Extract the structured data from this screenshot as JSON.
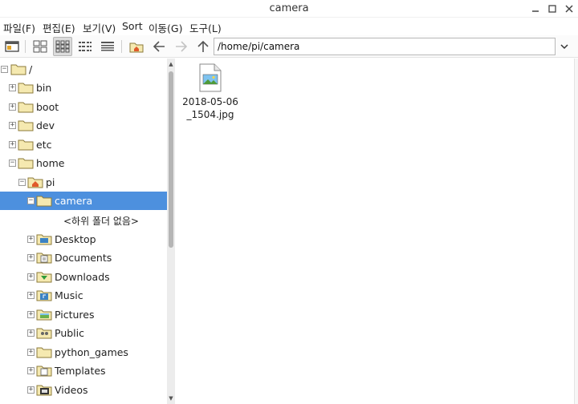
{
  "window": {
    "title": "camera"
  },
  "menu": [
    "파일(F)",
    "편집(E)",
    "보기(V)",
    "Sort",
    "이동(G)",
    "도구(L)"
  ],
  "toolbar": {
    "path": "/home/pi/camera"
  },
  "tree": {
    "root": "/",
    "items": {
      "bin": "bin",
      "boot": "boot",
      "dev": "dev",
      "etc": "etc",
      "home": "home",
      "pi": "pi",
      "camera": "camera",
      "no_subfolders": "<하위 폴더 없음>",
      "desktop": "Desktop",
      "documents": "Documents",
      "downloads": "Downloads",
      "music": "Music",
      "pictures": "Pictures",
      "public": "Public",
      "python_games": "python_games",
      "templates": "Templates",
      "videos": "Videos"
    }
  },
  "files": [
    {
      "name": "2018-05-06\n_1504.jpg"
    }
  ],
  "colors": {
    "selection": "#4d90de",
    "folder": "#f5e9b0",
    "folder_border": "#8c7a3a"
  }
}
